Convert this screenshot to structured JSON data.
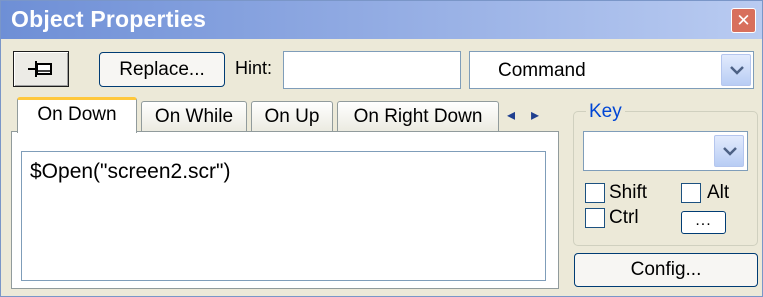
{
  "window": {
    "title": "Object Properties",
    "close_symbol": "✕"
  },
  "toolbar": {
    "pin_icon": "pin-icon",
    "replace_label": "Replace...",
    "hint_label": "Hint:",
    "hint_value": "",
    "command_value": "Command"
  },
  "tabs": [
    {
      "label": "On Down",
      "active": true
    },
    {
      "label": "On While",
      "active": false
    },
    {
      "label": "On Up",
      "active": false
    },
    {
      "label": "On Right Down",
      "active": false
    }
  ],
  "tab_scroll": {
    "left": "◂",
    "right": "▸"
  },
  "code": "$Open(\"screen2.scr\")",
  "key": {
    "legend": "Key",
    "selected": "",
    "shift_label": "Shift",
    "alt_label": "Alt",
    "ctrl_label": "Ctrl",
    "shift_checked": false,
    "alt_checked": false,
    "ctrl_checked": false,
    "more_label": "..."
  },
  "config_label": "Config...",
  "colors": {
    "title_gradient_start": "#6e8fd6",
    "title_gradient_end": "#b9cbf1",
    "panel_bg": "#ece9d8",
    "active_tab_accent": "#ffc83c",
    "legend_text": "#0046d5",
    "close_button": "#d86f5c"
  }
}
